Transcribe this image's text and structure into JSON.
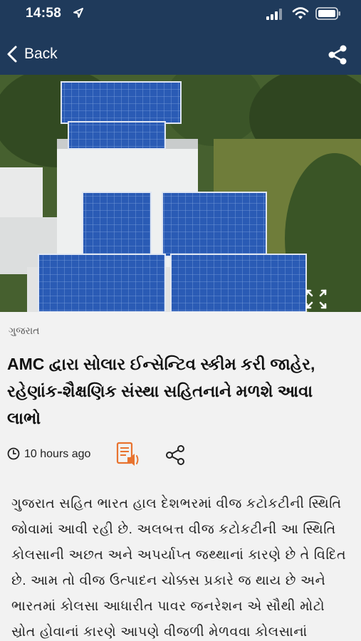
{
  "status_bar": {
    "time": "14:58"
  },
  "nav": {
    "back_label": "Back"
  },
  "article": {
    "category": "ગુજરાત",
    "title": "AMC દ્વારા સોલાર ઈન્સેન્ટિવ સ્કીમ કરી જાહેર, રહેણાંક-શૈક્ષણિક સંસ્થા સહિતનાને મળશે આવા લાભો",
    "time_ago": "10 hours ago",
    "body": "ગુજરાત સહિત ભારત હાલ દેશભરમાં વીજ કટોકટીની સ્થિતિ જોવામાં આવી રહી છે. અલબત્ત વીજ કટોકટીની આ સ્થિતિ કોલસાની અછત અને અપર્યાપ્ત જથ્થાનાં કારણે છે તે વિદિત છે. આમ તો વીજ ઉત્પાદન ચોક્કસ પ્રકારે જ થાય છે અને ભારતમાં કોલસા આધારીત પાવર જનરેશન એ સૌથી મોટો સ્રોત હોવાનાં કારણે આપણે  વીજળી મેળવવા કોલસાનાં"
  },
  "colors": {
    "header": "#1f3a5b",
    "accent": "#e8732f",
    "background": "#f2f2f2"
  },
  "icons": [
    "location-arrow-icon",
    "signal-icon",
    "wifi-icon",
    "battery-icon",
    "back-chevron-icon",
    "share-icon",
    "expand-icon",
    "clock-icon",
    "audio-article-icon"
  ]
}
